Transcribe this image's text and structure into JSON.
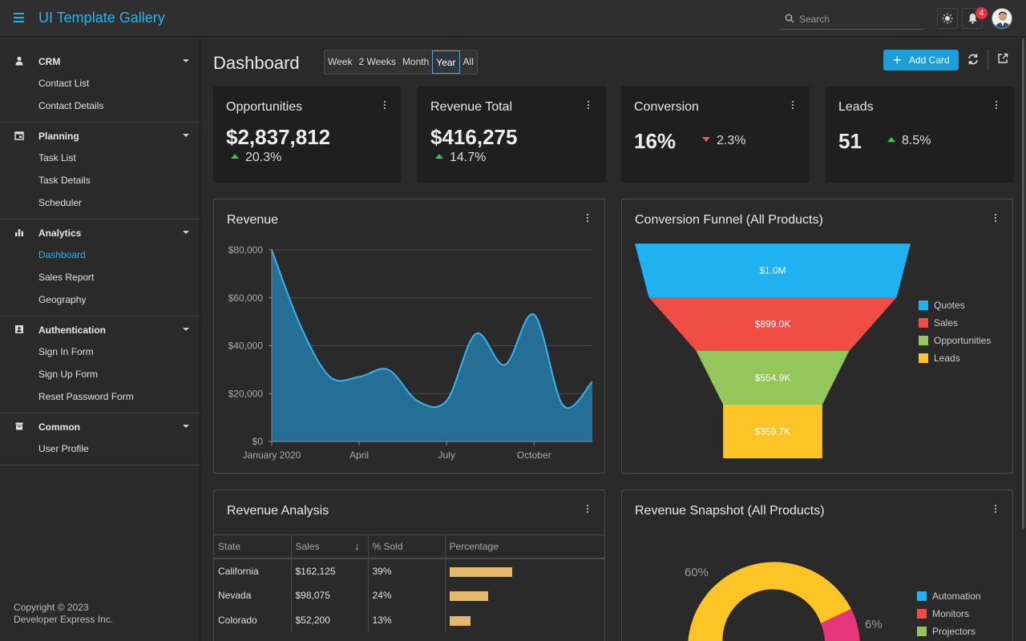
{
  "header": {
    "app_title": "UI Template Gallery",
    "search_placeholder": "Search",
    "notification_count": "4"
  },
  "sidebar": {
    "groups": [
      {
        "label": "CRM",
        "icon": "person-icon",
        "items": [
          "Contact List",
          "Contact Details"
        ]
      },
      {
        "label": "Planning",
        "icon": "calendar-icon",
        "items": [
          "Task List",
          "Task Details",
          "Scheduler"
        ]
      },
      {
        "label": "Analytics",
        "icon": "bar-chart-icon",
        "items": [
          "Dashboard",
          "Sales Report",
          "Geography"
        ]
      },
      {
        "label": "Authentication",
        "icon": "id-card-icon",
        "items": [
          "Sign In Form",
          "Sign Up Form",
          "Reset Password Form"
        ]
      },
      {
        "label": "Common",
        "icon": "box-icon",
        "items": [
          "User Profile"
        ]
      }
    ],
    "active_item": "Dashboard",
    "copyright_line1": "Copyright © 2023",
    "copyright_line2": "Developer Express Inc."
  },
  "toolbar": {
    "page_title": "Dashboard",
    "ranges": [
      "Week",
      "2 Weeks",
      "Month",
      "Year",
      "All"
    ],
    "selected_range": "Year",
    "add_card_label": "Add Card"
  },
  "kpis": [
    {
      "title": "Opportunities",
      "value": "$2,837,812",
      "delta": "20.3%",
      "direction": "up"
    },
    {
      "title": "Revenue Total",
      "value": "$416,275",
      "delta": "14.7%",
      "direction": "up"
    },
    {
      "title": "Conversion",
      "value": "16%",
      "delta": "2.3%",
      "direction": "down"
    },
    {
      "title": "Leads",
      "value": "51",
      "delta": "8.5%",
      "direction": "up"
    }
  ],
  "colors": {
    "accent": "#2ab3ee",
    "up": "#2ecc40",
    "down": "#ff5722",
    "area_fill": "#256f96",
    "area_line": "#33b6ef"
  },
  "revenue_card": {
    "title": "Revenue"
  },
  "funnel_card": {
    "title": "Conversion Funnel (All Products)"
  },
  "analysis_card": {
    "title": "Revenue Analysis",
    "columns": [
      "State",
      "Sales",
      "% Sold",
      "Percentage"
    ],
    "rows": [
      {
        "state": "California",
        "sales": "$162,125",
        "sold": "39%",
        "pct": 0.39
      },
      {
        "state": "Nevada",
        "sales": "$98,075",
        "sold": "24%",
        "pct": 0.24
      },
      {
        "state": "Colorado",
        "sales": "$52,200",
        "sold": "13%",
        "pct": 0.13
      }
    ]
  },
  "snapshot_card": {
    "title": "Revenue Snapshot (All Products)",
    "legend": [
      {
        "name": "Automation",
        "color": "#1fb1f0"
      },
      {
        "name": "Monitors",
        "color": "#f04e45"
      },
      {
        "name": "Projectors",
        "color": "#95c65a"
      }
    ],
    "labels": [
      "60%",
      "6%"
    ]
  },
  "chart_data": [
    {
      "type": "area",
      "title": "Revenue",
      "x": [
        "2020-01",
        "2020-02",
        "2020-03",
        "2020-04",
        "2020-05",
        "2020-06",
        "2020-07",
        "2020-08",
        "2020-09",
        "2020-10",
        "2020-11",
        "2020-12"
      ],
      "y": [
        80000,
        48000,
        27000,
        27000,
        30000,
        17000,
        17000,
        45000,
        32000,
        53000,
        15000,
        25000
      ],
      "x_tick_labels": [
        "January 2020",
        "April",
        "July",
        "October"
      ],
      "y_tick_labels": [
        "$0",
        "$20,000",
        "$40,000",
        "$60,000",
        "$80,000"
      ],
      "ylim": [
        0,
        80000
      ],
      "grid": true
    },
    {
      "type": "funnel",
      "title": "Conversion Funnel (All Products)",
      "categories": [
        "Quotes",
        "Sales",
        "Opportunities",
        "Leads"
      ],
      "values": [
        1000000,
        899000,
        554900,
        359700
      ],
      "labels": [
        "$1.0M",
        "$899.0K",
        "$554.9K",
        "$359.7K"
      ],
      "colors": [
        "#1fb1f0",
        "#f04e45",
        "#95c65a",
        "#fcc424"
      ],
      "legend": "right"
    },
    {
      "type": "pie",
      "title": "Revenue Snapshot (All Products)",
      "categories": [
        "Automation",
        "Monitors",
        "Projectors"
      ],
      "visible_labels": [
        "60%",
        "6%"
      ],
      "legend": "right"
    }
  ]
}
